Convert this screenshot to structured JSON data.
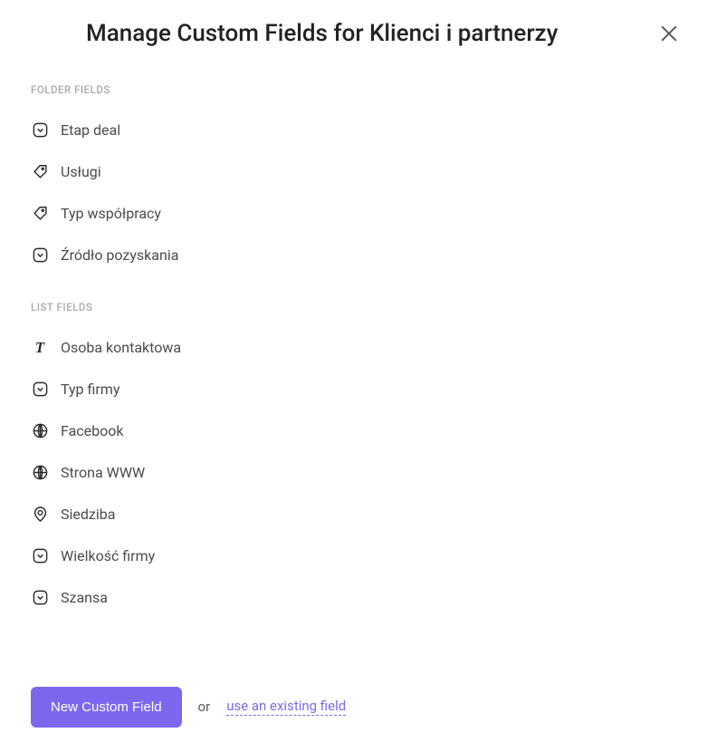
{
  "header": {
    "title": "Manage Custom Fields for Klienci i partnerzy"
  },
  "sections": {
    "folder": {
      "label": "FOLDER FIELDS",
      "items": [
        {
          "icon": "dropdown",
          "label": "Etap deal"
        },
        {
          "icon": "tag",
          "label": "Usługi"
        },
        {
          "icon": "tag",
          "label": "Typ współpracy"
        },
        {
          "icon": "dropdown",
          "label": "Źródło pozyskania"
        }
      ]
    },
    "list": {
      "label": "LIST FIELDS",
      "items": [
        {
          "icon": "text",
          "label": "Osoba kontaktowa"
        },
        {
          "icon": "dropdown",
          "label": "Typ firmy"
        },
        {
          "icon": "globe",
          "label": "Facebook"
        },
        {
          "icon": "globe",
          "label": "Strona WWW"
        },
        {
          "icon": "pin",
          "label": "Siedziba"
        },
        {
          "icon": "dropdown",
          "label": "Wielkość firmy"
        },
        {
          "icon": "dropdown",
          "label": "Szansa"
        }
      ]
    }
  },
  "footer": {
    "primary": "New Custom Field",
    "or": "or",
    "link": "use an existing field"
  }
}
